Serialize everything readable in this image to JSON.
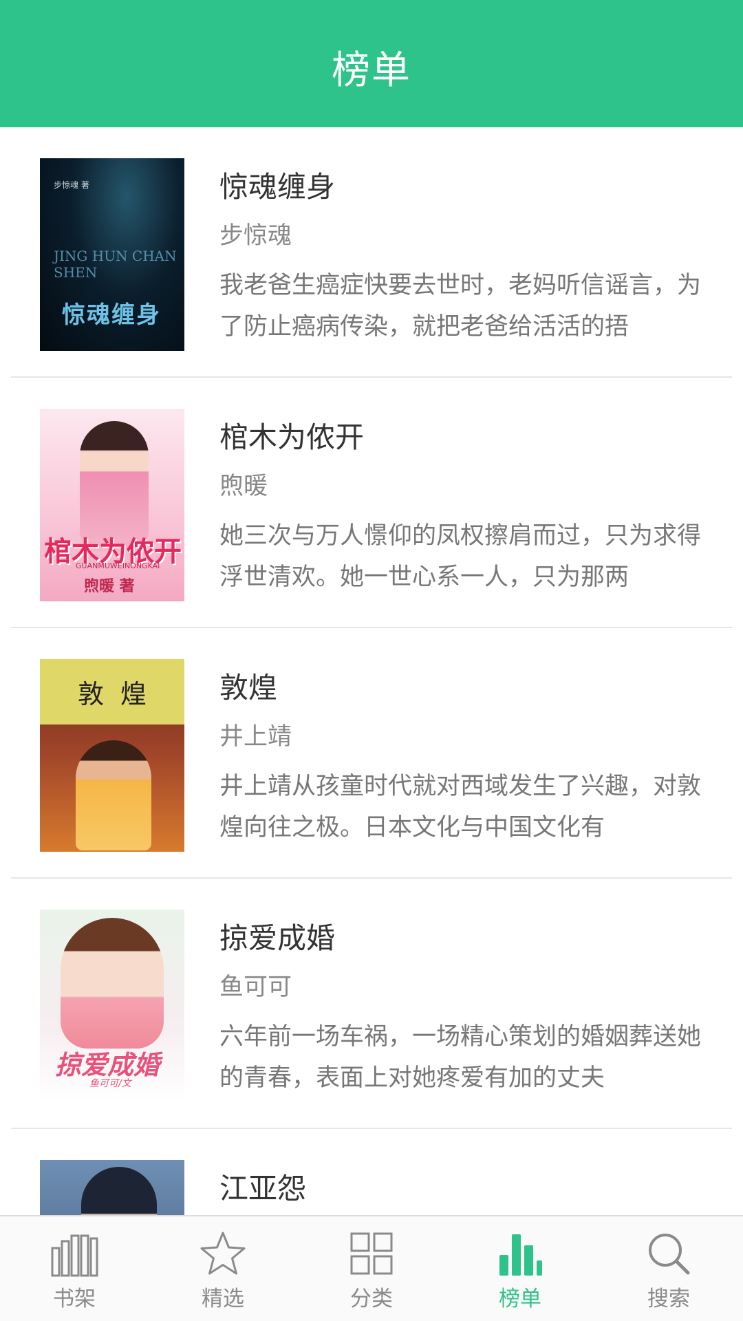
{
  "header": {
    "title": "榜单"
  },
  "books": [
    {
      "title": "惊魂缠身",
      "author": "步惊魂",
      "description": "我老爸生癌症快要去世时，老妈听信谣言，为了防止癌病传染，就把老爸给活活的捂",
      "cover": {
        "title": "惊魂缠身",
        "small": "步惊魂 著",
        "latin": "JING HUN CHAN SHEN"
      }
    },
    {
      "title": "棺木为侬开",
      "author": "煦暖",
      "description": "她三次与万人憬仰的凤权擦肩而过，只为求得浮世清欢。她一世心系一人，只为那两",
      "cover": {
        "title": "棺木为侬开",
        "latin": "GUANMUWEINONGKAI",
        "author": "煦暖 著"
      }
    },
    {
      "title": "敦煌",
      "author": "井上靖",
      "description": "井上靖从孩童时代就对西域发生了兴趣，对敦煌向往之极。日本文化与中国文化有",
      "cover": {
        "title": "敦煌"
      }
    },
    {
      "title": "掠爱成婚",
      "author": "鱼可可",
      "description": "六年前一场车祸，一场精心策划的婚姻葬送她的青春，表面上对她疼爱有加的丈夫",
      "cover": {
        "title": "掠爱成婚",
        "author": "鱼可可/文"
      }
    },
    {
      "title": "江亚怨",
      "author": "",
      "description": "",
      "cover": {}
    }
  ],
  "tabbar": {
    "active_color": "#2ec38a",
    "inactive_color": "#8a8a8a",
    "tabs": [
      {
        "label": "书架",
        "icon": "bookshelf-icon",
        "active": false
      },
      {
        "label": "精选",
        "icon": "star-icon",
        "active": false
      },
      {
        "label": "分类",
        "icon": "grid-icon",
        "active": false
      },
      {
        "label": "榜单",
        "icon": "bar-chart-icon",
        "active": true
      },
      {
        "label": "搜索",
        "icon": "search-icon",
        "active": false
      }
    ]
  },
  "colors": {
    "brand": "#2ec38a"
  }
}
